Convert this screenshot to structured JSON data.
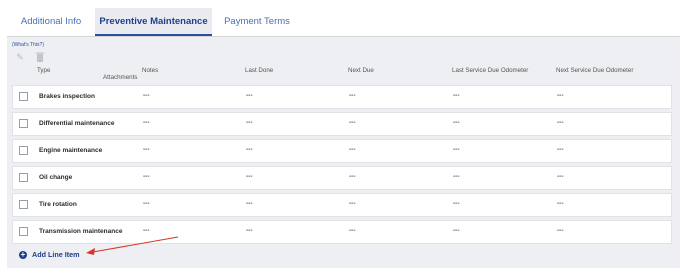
{
  "tabs": [
    {
      "label": "Additional Info"
    },
    {
      "label": "Preventive Maintenance"
    },
    {
      "label": "Payment Terms"
    }
  ],
  "toolbar": {
    "whats_this": "(What's This?)",
    "edit_icon": "pencil-icon",
    "delete_icon": "trash-icon"
  },
  "columns": {
    "type": "Type",
    "attachments": "Attachments",
    "notes": "Notes",
    "last_done": "Last Done",
    "next_due": "Next Due",
    "last_odometer": "Last Service Due Odometer",
    "next_odometer": "Next Service Due Odometer"
  },
  "rows": [
    {
      "type": "Brakes inspection",
      "notes": "---",
      "last_done": "---",
      "next_due": "---",
      "last_odometer": "---",
      "next_odometer": "---"
    },
    {
      "type": "Differential maintenance",
      "notes": "---",
      "last_done": "---",
      "next_due": "---",
      "last_odometer": "---",
      "next_odometer": "---"
    },
    {
      "type": "Engine maintenance",
      "notes": "---",
      "last_done": "---",
      "next_due": "---",
      "last_odometer": "---",
      "next_odometer": "---"
    },
    {
      "type": "Oil change",
      "notes": "---",
      "last_done": "---",
      "next_due": "---",
      "last_odometer": "---",
      "next_odometer": "---"
    },
    {
      "type": "Tire rotation",
      "notes": "---",
      "last_done": "---",
      "next_due": "---",
      "last_odometer": "---",
      "next_odometer": "---"
    },
    {
      "type": "Transmission maintenance",
      "notes": "---",
      "last_done": "---",
      "next_due": "---",
      "last_odometer": "---",
      "next_odometer": "---"
    }
  ],
  "add_line_item": "Add Line Item",
  "colors": {
    "accent": "#1f3f8a",
    "annotation_arrow": "#d9342b"
  }
}
